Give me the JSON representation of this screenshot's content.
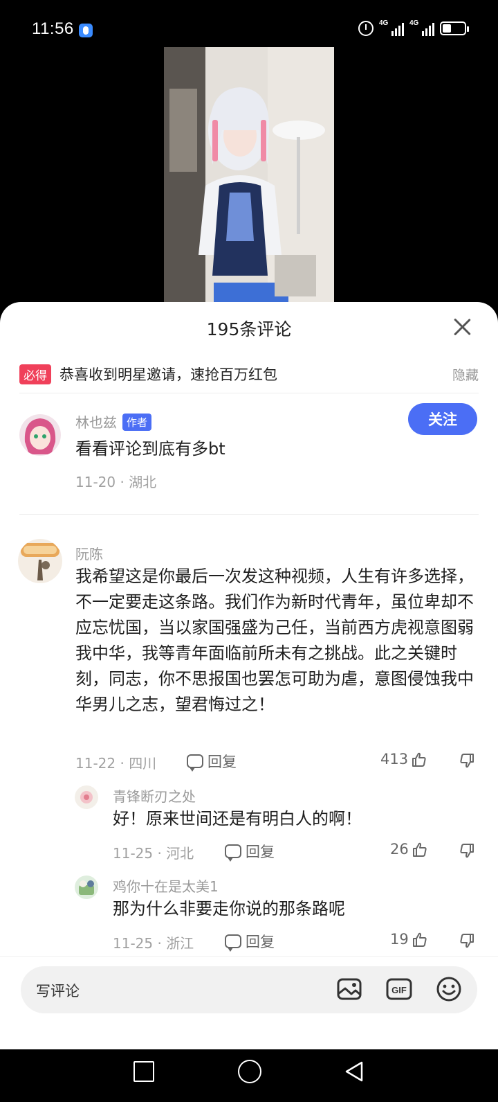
{
  "status_bar": {
    "time": "11:56",
    "net1": "4G",
    "net2": "4G"
  },
  "sheet": {
    "title": "195条评论"
  },
  "promo": {
    "badge": "必得",
    "text": "恭喜收到明星邀请，速抢百万红包",
    "hide": "隐藏"
  },
  "author_post": {
    "name": "林也兹",
    "tag": "作者",
    "follow": "关注",
    "text": "看看评论到底有多bt",
    "meta": "11-20 · 湖北"
  },
  "comments": [
    {
      "name": "阮陈",
      "text": "我希望这是你最后一次发这种视频，人生有许多选择，不一定要走这条路。我们作为新时代青年，虽位卑却不应忘忧国，当以家国强盛为己任，当前西方虎视意图弱我中华，我等青年面临前所未有之挑战。此之关键时刻，同志，你不思报国也罢怎可助为虐，意图侵蚀我中华男儿之志，望君悔过之！",
      "meta": "11-22 · 四川",
      "reply": "回复",
      "likes": "413"
    }
  ],
  "replies": [
    {
      "name": "青锋断刃之处",
      "text": "好！原来世间还是有明白人的啊！",
      "meta": "11-25 · 河北",
      "reply": "回复",
      "likes": "26"
    },
    {
      "name": "鸡你十在是太美1",
      "text": "那为什么非要走你说的那条路呢",
      "meta": "11-25 · 浙江",
      "reply": "回复",
      "likes": "19"
    }
  ],
  "input": {
    "placeholder": "写评论"
  },
  "colors": {
    "accent": "#4b6ef5",
    "promo_badge": "#f0405a"
  },
  "icons": [
    "close-icon",
    "reply-icon",
    "thumb-up-icon",
    "thumb-down-icon",
    "image-icon",
    "gif-icon",
    "emoji-icon"
  ]
}
